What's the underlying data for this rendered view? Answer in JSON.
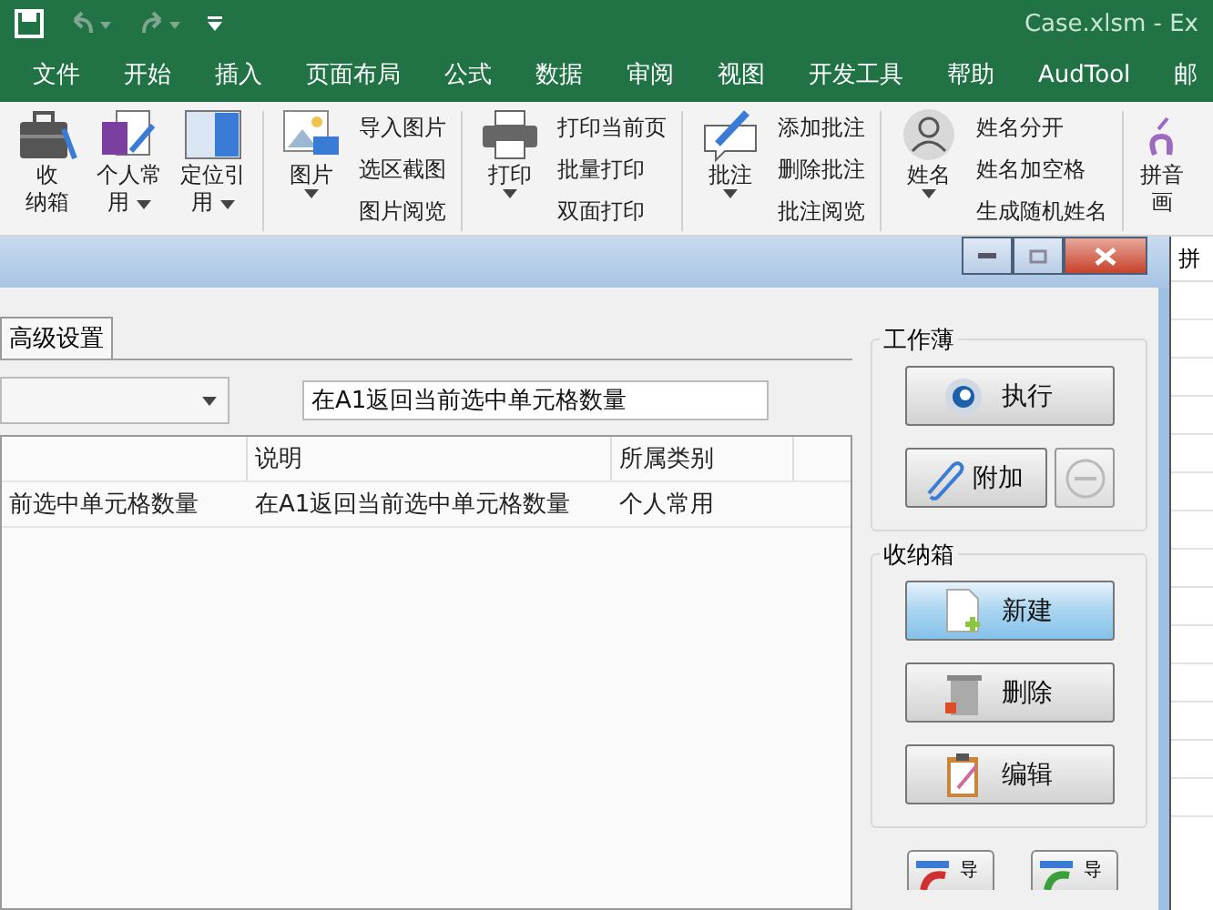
{
  "window": {
    "title": "Case.xlsm  -  Ex"
  },
  "menu": [
    {
      "label": "文件",
      "selected": false
    },
    {
      "label": "开始",
      "selected": false
    },
    {
      "label": "插入",
      "selected": false
    },
    {
      "label": "页面布局",
      "selected": false
    },
    {
      "label": "公式",
      "selected": false
    },
    {
      "label": "数据",
      "selected": false
    },
    {
      "label": "审阅",
      "selected": false
    },
    {
      "label": "视图",
      "selected": false
    },
    {
      "label": "开发工具",
      "selected": false
    },
    {
      "label": "帮助",
      "selected": false
    },
    {
      "label": "AudTool",
      "selected": false
    },
    {
      "label": "邮",
      "selected": false
    }
  ],
  "ribbon": [
    {
      "kind": "large",
      "lines": [
        "收",
        "纳箱"
      ],
      "caret": false
    },
    {
      "kind": "large",
      "lines": [
        "个人常",
        "用"
      ],
      "caret": true
    },
    {
      "kind": "large",
      "lines": [
        "定位引",
        "用"
      ],
      "caret": true
    },
    {
      "kind": "sep"
    },
    {
      "kind": "large",
      "lines": [
        "图片"
      ],
      "caret": true
    },
    {
      "kind": "small",
      "items": [
        "导入图片",
        "选区截图",
        "图片阅览"
      ]
    },
    {
      "kind": "sep"
    },
    {
      "kind": "large",
      "lines": [
        "打印"
      ],
      "caret": true
    },
    {
      "kind": "small",
      "items": [
        "打印当前页",
        "批量打印",
        "双面打印"
      ]
    },
    {
      "kind": "sep"
    },
    {
      "kind": "large",
      "lines": [
        "批注"
      ],
      "caret": true
    },
    {
      "kind": "small",
      "items": [
        "添加批注",
        "删除批注",
        "批注阅览"
      ]
    },
    {
      "kind": "sep"
    },
    {
      "kind": "large",
      "lines": [
        "姓名"
      ],
      "caret": true
    },
    {
      "kind": "small",
      "items": [
        "姓名分开",
        "姓名加空格",
        "生成随机姓名"
      ]
    },
    {
      "kind": "sep"
    },
    {
      "kind": "large",
      "lines": [
        "拼音",
        "画"
      ],
      "caret": false
    }
  ],
  "sheet": {
    "cell": "拼"
  },
  "dialog": {
    "tabs": [
      {
        "label": "高级设置",
        "selected": true
      }
    ],
    "description_field": {
      "value": "在A1返回当前选中单元格数量"
    },
    "table": {
      "columns": [
        "",
        "说明",
        "所属类别"
      ],
      "rows": [
        {
          "cells": [
            "前选中单元格数量",
            "在A1返回当前选中单元格数量",
            "个人常用"
          ],
          "selected": false
        }
      ]
    },
    "groups": [
      {
        "title": "工作薄",
        "buttons": [
          {
            "label": "执行",
            "hovered": false,
            "kind": "wide"
          },
          {
            "label": "附加",
            "hovered": false,
            "kind": "half"
          },
          {
            "hovered": false,
            "kind": "square"
          }
        ]
      },
      {
        "title": "收纳箱",
        "buttons": [
          {
            "label": "新建",
            "hovered": true,
            "kind": "wide"
          },
          {
            "label": "删除",
            "hovered": false,
            "kind": "wide"
          },
          {
            "label": "编辑",
            "hovered": false,
            "kind": "wide"
          }
        ]
      }
    ],
    "bottom_buttons": [
      {
        "label": "导"
      },
      {
        "label": "导"
      }
    ]
  }
}
